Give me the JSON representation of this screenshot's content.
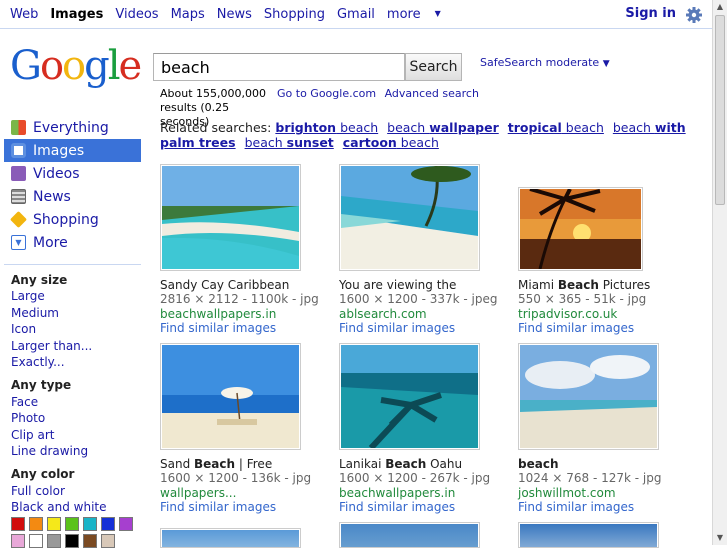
{
  "topnav": {
    "items": [
      "Web",
      "Images",
      "Videos",
      "Maps",
      "News",
      "Shopping",
      "Gmail"
    ],
    "more": "more",
    "signin": "Sign in"
  },
  "logo": "Google",
  "search": {
    "query": "beach",
    "button": "Search",
    "safesearch": "SafeSearch moderate"
  },
  "stats": {
    "text": "About 155,000,000 results (0.25 seconds)",
    "goto": "Go to Google.com",
    "advanced": "Advanced search"
  },
  "related": {
    "label": "Related searches:",
    "items": [
      {
        "bold": "brighton",
        "rest": " beach"
      },
      {
        "pre": "beach ",
        "bold": "wallpaper"
      },
      {
        "bold": "tropical",
        "rest": " beach"
      },
      {
        "pre": "beach ",
        "bold": "with palm trees"
      },
      {
        "pre": "beach ",
        "bold": "sunset"
      },
      {
        "bold": "cartoon",
        "rest": " beach"
      }
    ]
  },
  "leftnav": {
    "items": [
      "Everything",
      "Images",
      "Videos",
      "News",
      "Shopping",
      "More"
    ],
    "selected": "Images",
    "icon_colors": [
      "#7ab648",
      "#3a72d8",
      "#8a5cb8",
      "#888888",
      "#f2b50f",
      "#3a72d8"
    ]
  },
  "filters": {
    "size_header": "Any size",
    "sizes": [
      "Large",
      "Medium",
      "Icon",
      "Larger than...",
      "Exactly..."
    ],
    "type_header": "Any type",
    "types": [
      "Face",
      "Photo",
      "Clip art",
      "Line drawing"
    ],
    "color_header": "Any color",
    "colors": [
      "Full color",
      "Black and white"
    ],
    "swatches": [
      "#d10d0d",
      "#f38a12",
      "#f5e81a",
      "#5bc21a",
      "#19b3c7",
      "#1530d6",
      "#a63fcf",
      "#e8a8d8",
      "#ffffff",
      "#999999",
      "#000000",
      "#7a4a22",
      "#d8c8b8"
    ]
  },
  "results": [
    {
      "title": "Sandy Cay Caribbean",
      "meta": "2816 × 2112 - 1100k - jpg",
      "url": "beachwallpapers.in",
      "similar": "Find similar images"
    },
    {
      "title": "You are viewing the",
      "meta": "1600 × 1200 - 337k - jpeg",
      "url": "ablsearch.com",
      "similar": "Find similar images"
    },
    {
      "title": "Miami Beach Pictures",
      "meta": "550 × 365 - 51k - jpg",
      "url": "tripadvisor.co.uk",
      "similar": "Find similar images"
    },
    {
      "title": "Sand Beach | Free",
      "meta": "1600 × 1200 - 136k - jpg",
      "url": "wallpapers...",
      "similar": "Find similar images"
    },
    {
      "title": "Lanikai Beach Oahu",
      "meta": "1600 × 1200 - 267k - jpg",
      "url": "beachwallpapers.in",
      "similar": "Find similar images"
    },
    {
      "title": "beach",
      "meta": "1024 × 768 - 127k - jpg",
      "url": "joshwillmot.com",
      "similar": "Find similar images"
    }
  ]
}
